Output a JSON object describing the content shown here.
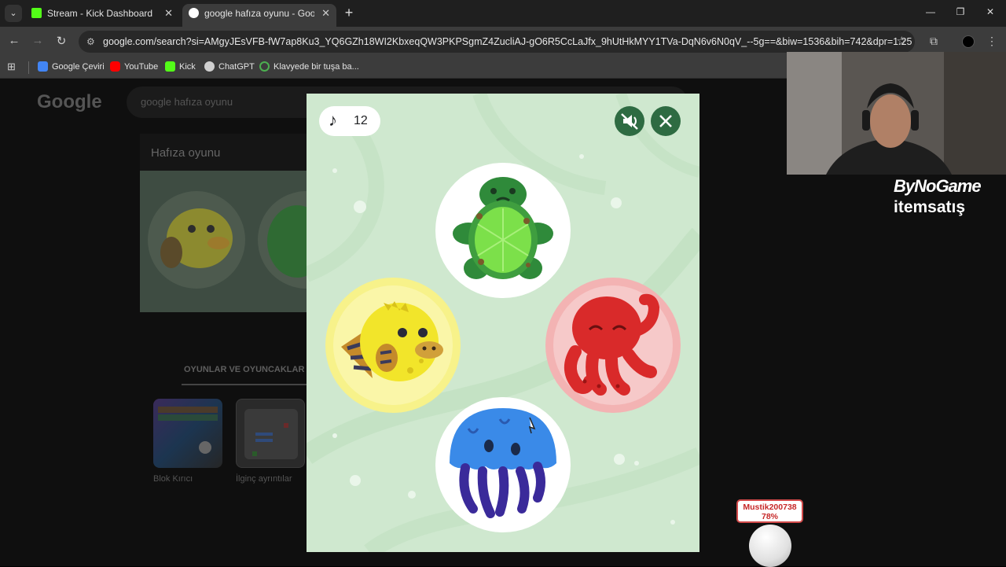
{
  "browser": {
    "tabs": [
      {
        "title": "Stream - Kick Dashboard",
        "icon": "kick-icon",
        "active": false
      },
      {
        "title": "google hafıza oyunu - Google'da Ara",
        "icon": "google-icon",
        "active": true
      }
    ],
    "tab_close_label": "✕",
    "new_tab_label": "+",
    "url": "google.com/search?si=AMgyJEsVFB-fW7ap8Ku3_YQ6GZh18WI2KbxeqQW3PKPSgmZ4ZucliAJ-gO6R5CcLaJfx_9hUtHkMYY1TVa-DqN6v6N0qV_--5g==&biw=1536&bih=742&dpr=1.25",
    "bookmarks": [
      {
        "label": "Google Çeviri",
        "color": "#4285f4"
      },
      {
        "label": "YouTube",
        "color": "#ff0000"
      },
      {
        "label": "Kick",
        "color": "#53fc18"
      },
      {
        "label": "ChatGPT",
        "color": "#d0d0d0"
      },
      {
        "label": "Klavyede bir tuşa ba...",
        "color": "#4caf50"
      }
    ]
  },
  "google": {
    "logo": "Google",
    "query": "google hafıza oyunu",
    "section_title": "Hafıza oyunu",
    "tab_label": "OYUNLAR VE OYUNCAKLAR",
    "tiles": [
      {
        "label": "Blok Kırıcı"
      },
      {
        "label": "İlginç ayrıntılar"
      }
    ]
  },
  "game": {
    "score": "12",
    "score_icon": "music-note-icon",
    "mute_icon": "volume-off-icon",
    "close_icon": "close-icon",
    "background": "#cfe8cf",
    "accent": "#2e6b42",
    "creatures": [
      {
        "name": "turtle",
        "highlight": "none"
      },
      {
        "name": "pufferfish",
        "highlight": "#f7f28a"
      },
      {
        "name": "octopus",
        "highlight": "#f3b3b3"
      },
      {
        "name": "jellyfish",
        "highlight": "none"
      }
    ]
  },
  "stream_overlay": {
    "sponsor_line1": "ByNoGame",
    "sponsor_line2": "itemsatış",
    "donation_name": "Mustik200738",
    "donation_percent": "78%"
  }
}
